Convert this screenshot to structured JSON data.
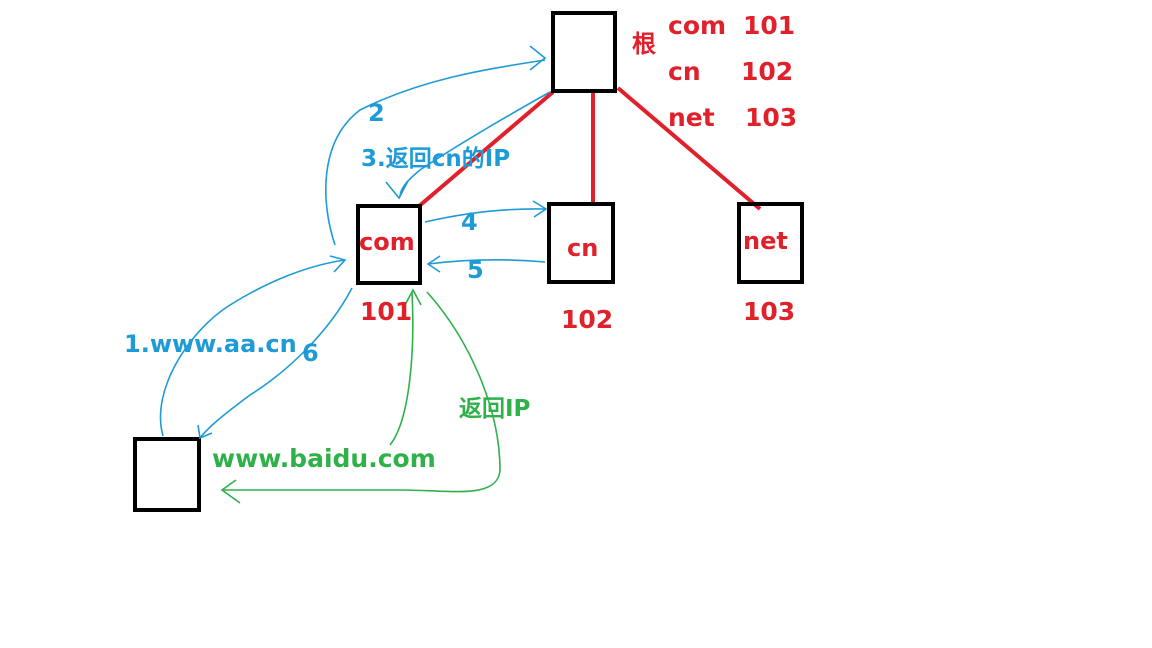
{
  "colors": {
    "box": "#000000",
    "tree": "#e0202a",
    "blue": "#1e9bd7",
    "green": "#2fb14a",
    "background": "#ffffff"
  },
  "root": {
    "label": "根",
    "table": [
      {
        "domain": "com",
        "ip": "101"
      },
      {
        "domain": "cn",
        "ip": "102"
      },
      {
        "domain": "net",
        "ip": "103"
      }
    ]
  },
  "servers": [
    {
      "id": "com",
      "label": "com",
      "ip": "101"
    },
    {
      "id": "cn",
      "label": "cn",
      "ip": "102"
    },
    {
      "id": "net",
      "label": "net",
      "ip": "103"
    }
  ],
  "steps": {
    "s1": "1.www.aa.cn",
    "s2": "2",
    "s3": "3.返回cn的IP",
    "s4": "4",
    "s5": "5",
    "s6": "6"
  },
  "green": {
    "query": "www.baidu.com",
    "reply": "返回IP"
  }
}
